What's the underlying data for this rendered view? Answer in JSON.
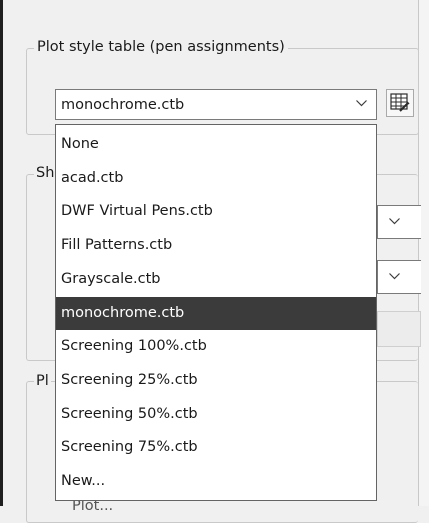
{
  "plot_style_group": {
    "title": "Plot style table (pen assignments)",
    "selected": "monochrome.ctb",
    "table_button_icon": "plot-style-table-editor-icon"
  },
  "hidden_group_fragments": {
    "shaded_prefix": "Sh",
    "plot_options_prefix": "Pl",
    "checkbox_fragment": "Plot..."
  },
  "dropdown": {
    "options": [
      "None",
      "acad.ctb",
      "DWF Virtual Pens.ctb",
      "Fill Patterns.ctb",
      "Grayscale.ctb",
      "monochrome.ctb",
      "Screening 100%.ctb",
      "Screening 25%.ctb",
      "Screening 50%.ctb",
      "Screening 75%.ctb",
      "New..."
    ],
    "selected_index": 5
  },
  "colors": {
    "selection_bg": "#3b3b3b",
    "window_bg": "#f0f0f0",
    "border": "#c9c9c9"
  },
  "icons": {
    "combo_arrow": "chevron-down-icon"
  }
}
